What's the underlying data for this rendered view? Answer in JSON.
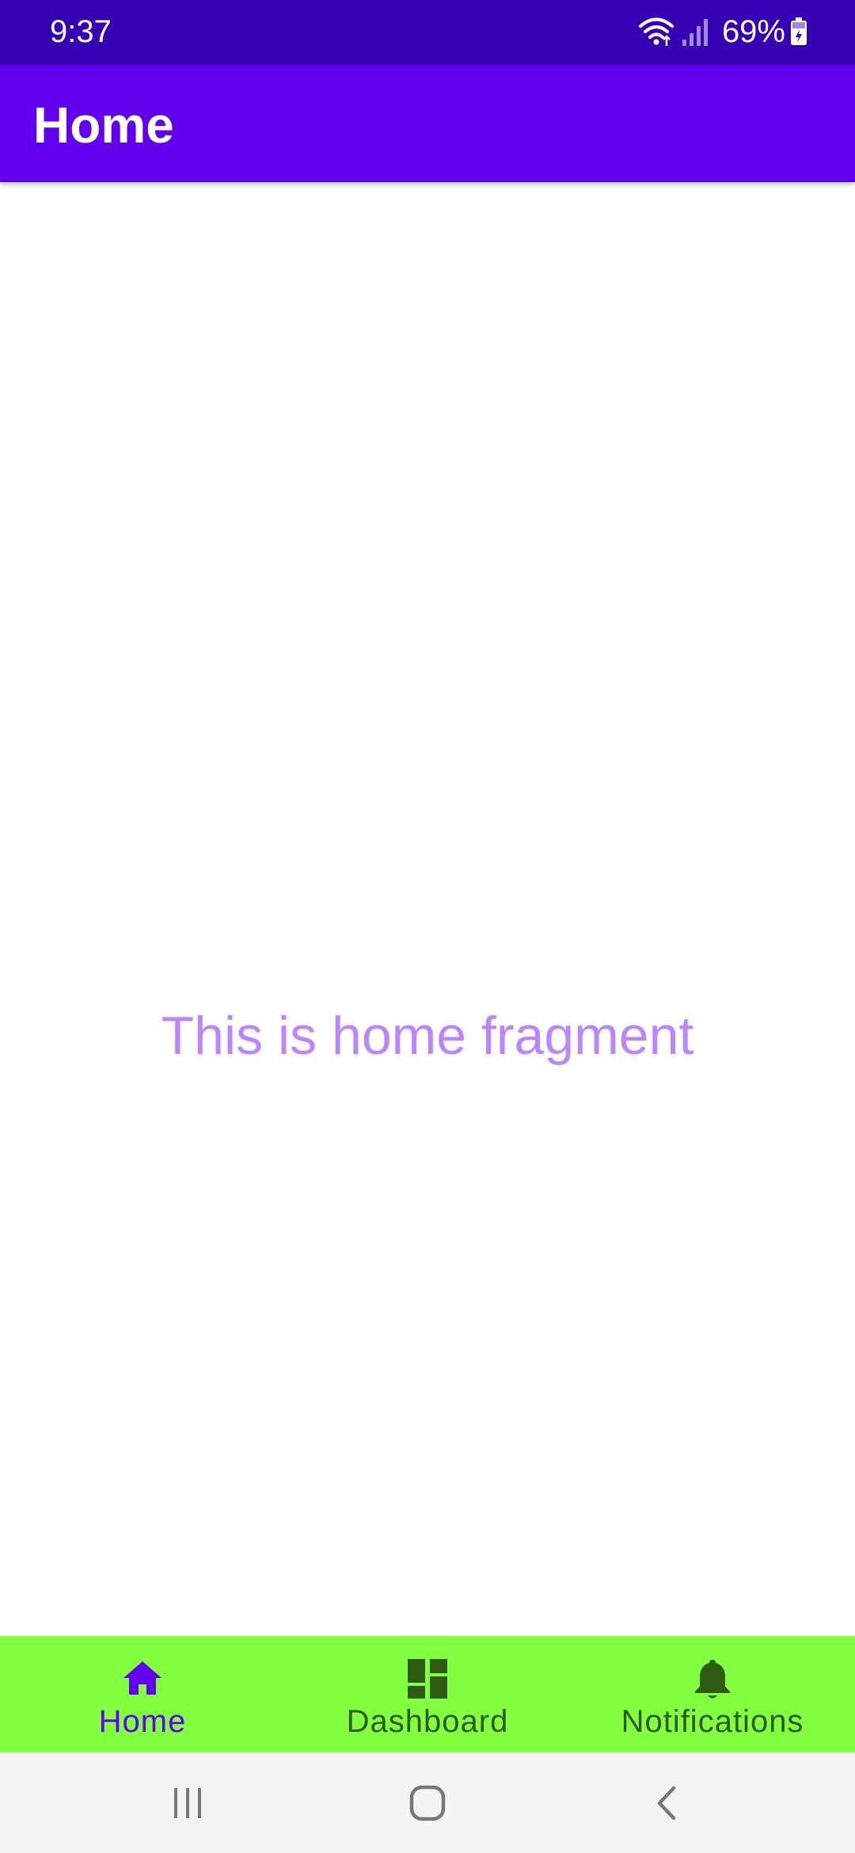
{
  "status_bar": {
    "time": "9:37",
    "battery_percent": "69%",
    "icons": [
      "wifi-icon",
      "signal-icon",
      "battery-icon"
    ]
  },
  "app_bar": {
    "title": "Home"
  },
  "content": {
    "message": "This is home fragment"
  },
  "bottom_nav": {
    "items": [
      {
        "label": "Home",
        "icon": "home-icon",
        "active": true
      },
      {
        "label": "Dashboard",
        "icon": "dashboard-icon",
        "active": false
      },
      {
        "label": "Notifications",
        "icon": "bell-icon",
        "active": false
      }
    ]
  },
  "system_nav": {
    "buttons": [
      "recent-apps-icon",
      "home-circle-icon",
      "back-icon"
    ]
  },
  "colors": {
    "status_bar": "#3700b3",
    "app_bar": "#6200ee",
    "content_text": "#bb86fc",
    "bottom_nav_background": "#82ff3f",
    "active_nav": "#6200ee",
    "inactive_nav": "#2e5a12",
    "system_nav_background": "#f4f4f4"
  }
}
